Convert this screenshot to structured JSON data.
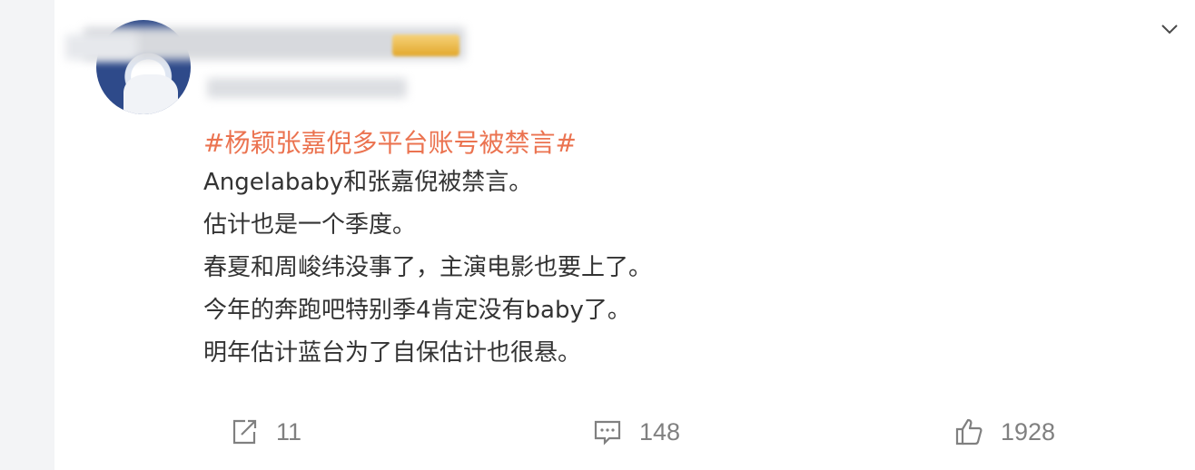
{
  "post": {
    "hashtag": "#杨颖张嘉倪多平台账号被禁言#",
    "lines": [
      "Angelababy和张嘉倪被禁言。",
      "估计也是一个季度。",
      "春夏和周峻纬没事了，主演电影也要上了。",
      "今年的奔跑吧特别季4肯定没有baby了。",
      "明年估计蓝台为了自保估计也很悬。"
    ]
  },
  "actions": {
    "repost_count": "11",
    "comment_count": "148",
    "like_count": "1928"
  },
  "icons": {
    "menu": "chevron-down-icon",
    "repost": "share-icon",
    "comment": "comment-icon",
    "like": "thumbs-up-icon"
  },
  "colors": {
    "hashtag": "#eb7350",
    "text": "#333333",
    "action": "#808080",
    "crown": "#e2a82c"
  }
}
